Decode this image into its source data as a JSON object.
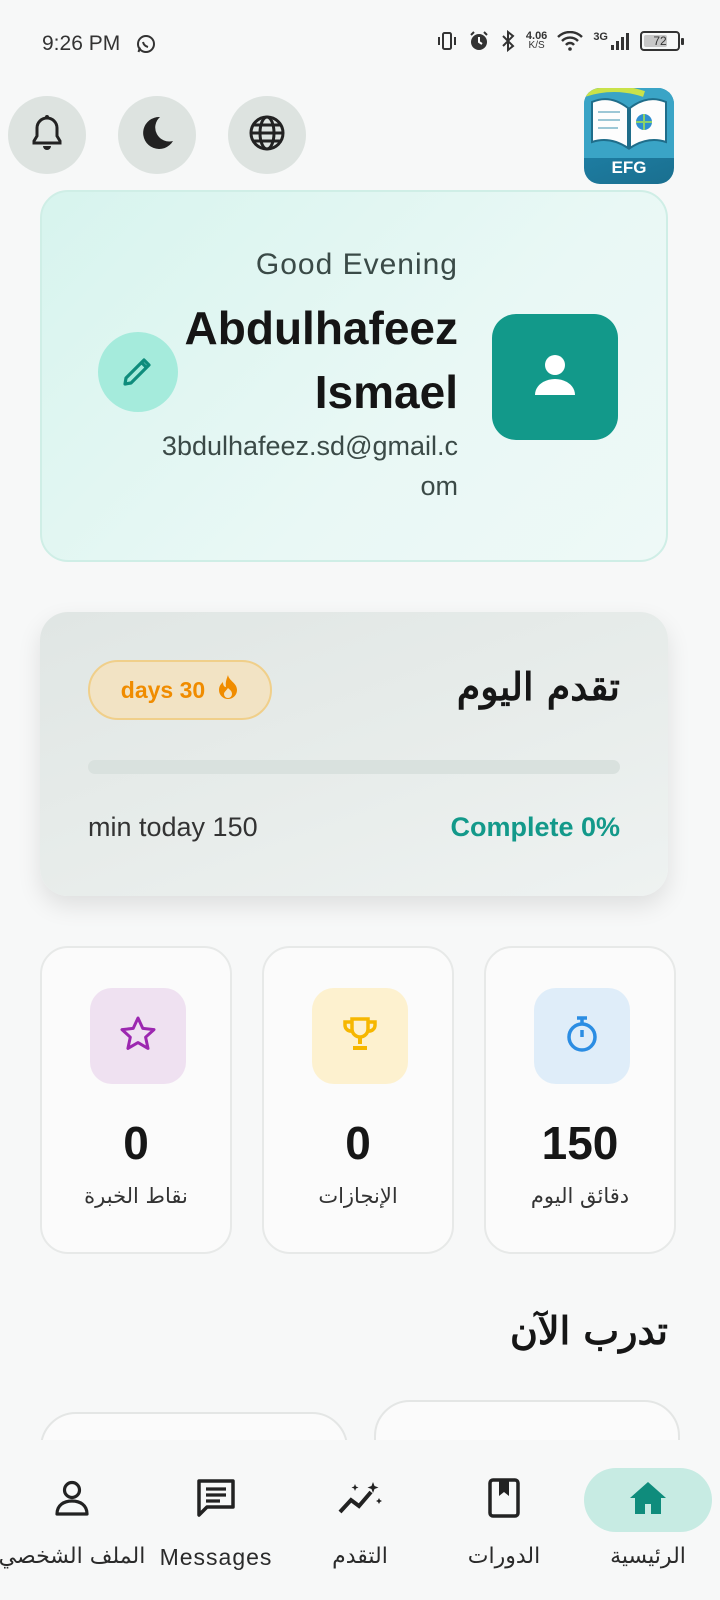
{
  "status_bar": {
    "time": "9:26 PM",
    "net_speed_value": "4.06",
    "net_speed_unit": "K/S",
    "network_type": "3G",
    "battery_level": "72"
  },
  "top_actions": {
    "notifications_icon": "bell-icon",
    "theme_icon": "moon-icon",
    "language_icon": "globe-icon",
    "logo_text": "EFG"
  },
  "profile": {
    "greeting": "Good Evening",
    "name": "Abdulhafeez Ismael",
    "email": "3bdulhafeez.sd@gmail.com"
  },
  "today_progress": {
    "title": "تقدم اليوم",
    "streak": "days 30",
    "progress_fraction": 0,
    "minutes_text": "min today 150",
    "complete_text": "Complete 0%"
  },
  "stats": [
    {
      "label": "نقاط الخبرة",
      "value": "0",
      "icon": "star-icon",
      "color": "#9c27b0",
      "bg": "#efe1f1"
    },
    {
      "label": "الإنجازات",
      "value": "0",
      "icon": "trophy-icon",
      "color": "#f6b700",
      "bg": "#fdf1cf"
    },
    {
      "label": "دقائق اليوم",
      "value": "150",
      "icon": "timer-icon",
      "color": "#2b8de3",
      "bg": "#dfedf9"
    }
  ],
  "train_now": {
    "title": "تدرب الآن"
  },
  "bottom_nav": {
    "home": "الرئيسية",
    "courses": "الدورات",
    "progress": "التقدم",
    "messages": "Messages",
    "profile": "الملف الشخصي"
  },
  "colors": {
    "primary": "#13998a",
    "streak": "#f08c00"
  }
}
